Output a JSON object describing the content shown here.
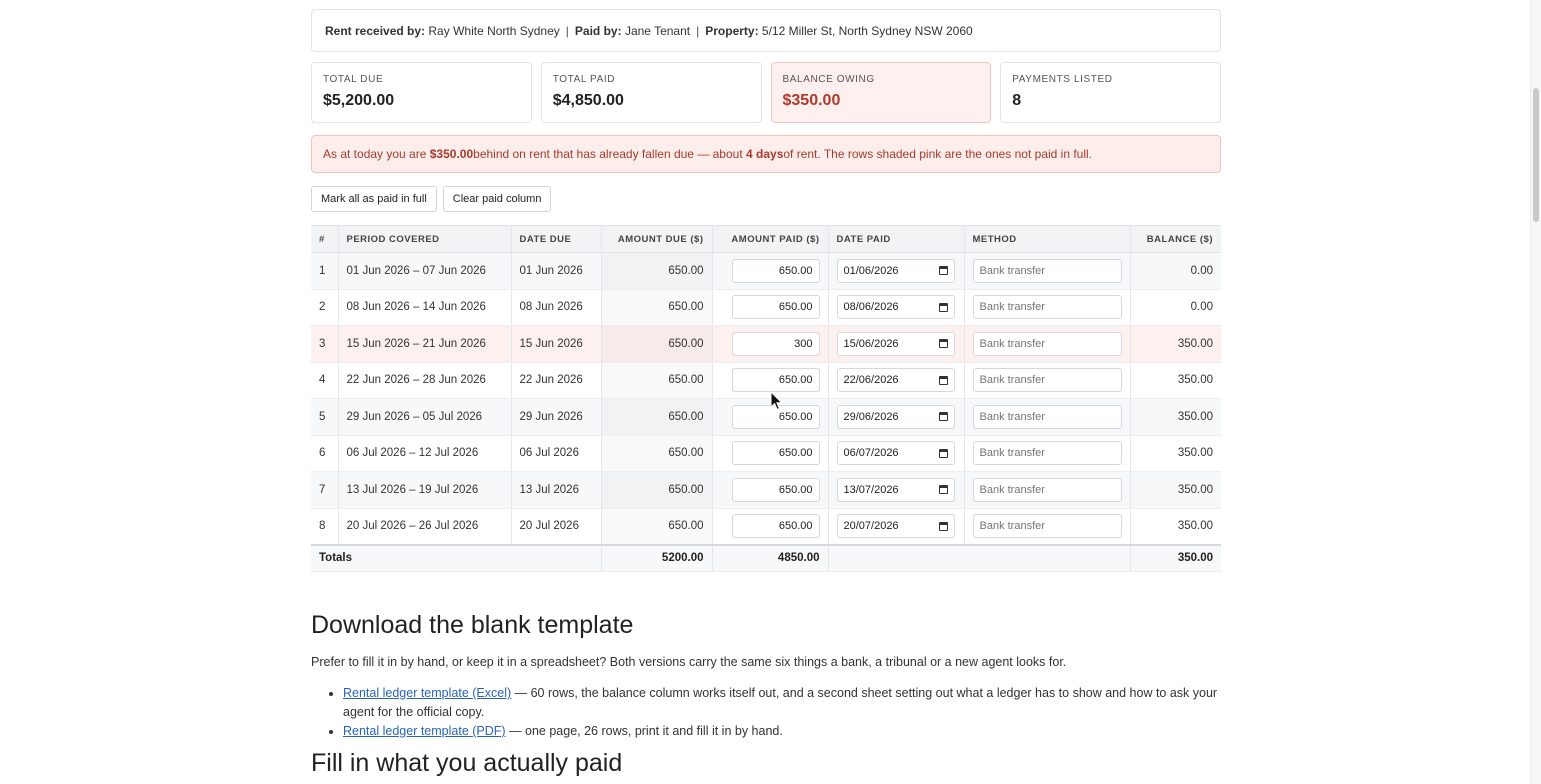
{
  "info": {
    "rent_received_label": "Rent received by:",
    "rent_received_value": "Ray White North Sydney",
    "paid_by_label": "Paid by:",
    "paid_by_value": "Jane Tenant",
    "property_label": "Property:",
    "property_value": "5/12 Miller St, North Sydney NSW 2060",
    "separator": "|"
  },
  "cards": {
    "total_due": {
      "label": "TOTAL DUE",
      "value": "$5,200.00"
    },
    "total_paid": {
      "label": "TOTAL PAID",
      "value": "$4,850.00"
    },
    "balance_owing": {
      "label": "BALANCE OWING",
      "value": "$350.00"
    },
    "payments_listed": {
      "label": "PAYMENTS LISTED",
      "value": "8"
    }
  },
  "alert": {
    "part1": "As at today you are ",
    "amount": "$350.00",
    "part2": " behind on rent that has already fallen due — about ",
    "days": "4 days",
    "part3": " of rent. The rows shaded pink are the ones not paid in full."
  },
  "buttons": {
    "mark_all": "Mark all as paid in full",
    "clear_paid": "Clear paid column"
  },
  "table": {
    "headers": {
      "num": "#",
      "period": "PERIOD COVERED",
      "date_due": "DATE DUE",
      "amount_due": "AMOUNT DUE ($)",
      "amount_paid": "AMOUNT PAID ($)",
      "date_paid": "DATE PAID",
      "method": "METHOD",
      "balance": "BALANCE ($)"
    },
    "method_placeholder": "Bank transfer",
    "rows": [
      {
        "num": "1",
        "period": "01 Jun 2026 – 07 Jun 2026",
        "date_due": "01 Jun 2026",
        "amount_due": "650.00",
        "amount_paid": "650.00",
        "date_paid": "01/06/2026",
        "balance": "0.00",
        "short": false
      },
      {
        "num": "2",
        "period": "08 Jun 2026 – 14 Jun 2026",
        "date_due": "08 Jun 2026",
        "amount_due": "650.00",
        "amount_paid": "650.00",
        "date_paid": "08/06/2026",
        "balance": "0.00",
        "short": false
      },
      {
        "num": "3",
        "period": "15 Jun 2026 – 21 Jun 2026",
        "date_due": "15 Jun 2026",
        "amount_due": "650.00",
        "amount_paid": "300",
        "date_paid": "15/06/2026",
        "balance": "350.00",
        "short": true
      },
      {
        "num": "4",
        "period": "22 Jun 2026 – 28 Jun 2026",
        "date_due": "22 Jun 2026",
        "amount_due": "650.00",
        "amount_paid": "650.00",
        "date_paid": "22/06/2026",
        "balance": "350.00",
        "short": false
      },
      {
        "num": "5",
        "period": "29 Jun 2026 – 05 Jul 2026",
        "date_due": "29 Jun 2026",
        "amount_due": "650.00",
        "amount_paid": "650.00",
        "date_paid": "29/06/2026",
        "balance": "350.00",
        "short": false
      },
      {
        "num": "6",
        "period": "06 Jul 2026 – 12 Jul 2026",
        "date_due": "06 Jul 2026",
        "amount_due": "650.00",
        "amount_paid": "650.00",
        "date_paid": "06/07/2026",
        "balance": "350.00",
        "short": false
      },
      {
        "num": "7",
        "period": "13 Jul 2026 – 19 Jul 2026",
        "date_due": "13 Jul 2026",
        "amount_due": "650.00",
        "amount_paid": "650.00",
        "date_paid": "13/07/2026",
        "balance": "350.00",
        "short": false
      },
      {
        "num": "8",
        "period": "20 Jul 2026 – 26 Jul 2026",
        "date_due": "20 Jul 2026",
        "amount_due": "650.00",
        "amount_paid": "650.00",
        "date_paid": "20/07/2026",
        "balance": "350.00",
        "short": false
      }
    ],
    "totals": {
      "label": "Totals",
      "amount_due": "5200.00",
      "amount_paid": "4850.00",
      "balance": "350.00"
    }
  },
  "download": {
    "heading": "Download the blank template",
    "intro": "Prefer to fill it in by hand, or keep it in a spreadsheet? Both versions carry the same six things a bank, a tribunal or a new agent looks for.",
    "items": [
      {
        "link": "Rental ledger template (Excel)",
        "text": " — 60 rows, the balance column works itself out, and a second sheet setting out what a ledger has to show and how to ask your agent for the official copy."
      },
      {
        "link": "Rental ledger template (PDF)",
        "text": " — one page, 26 rows, print it and fill it in by hand."
      }
    ]
  },
  "next_heading": "Fill in what you actually paid"
}
